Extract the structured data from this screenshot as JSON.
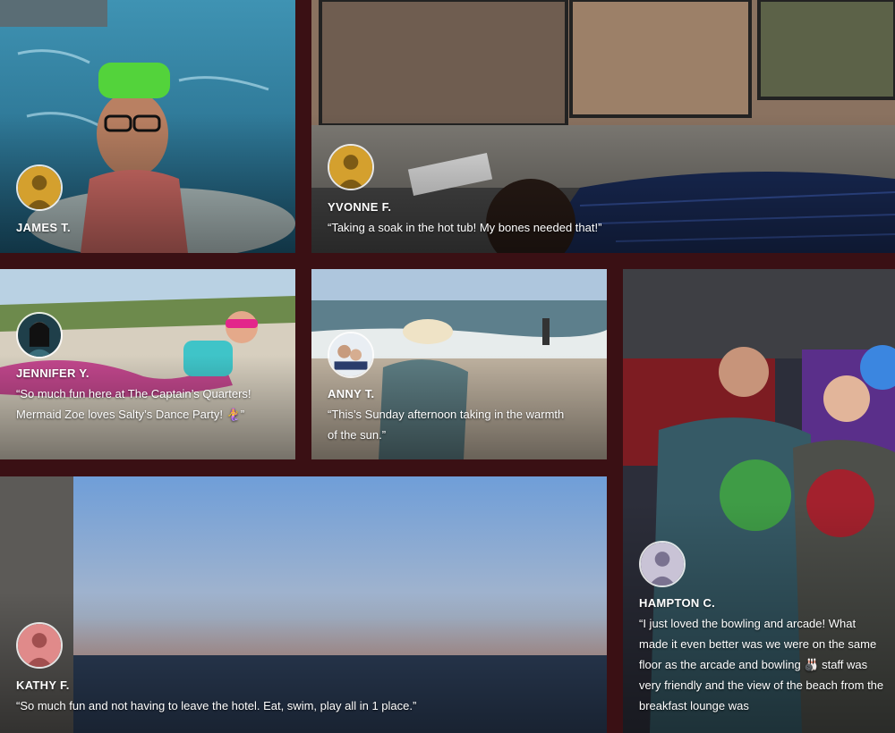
{
  "reviews": [
    {
      "name": "JAMES T.",
      "quote": ""
    },
    {
      "name": "YVONNE F.",
      "quote": "“Taking a soak in the hot tub! My bones needed that!”"
    },
    {
      "name": "JENNIFER Y.",
      "quote": "“So much fun here at The Captain’s Quarters! Mermaid Zoe loves Salty’s Dance Party! 🧜‍♀️”"
    },
    {
      "name": "ANNY T.",
      "quote": "“This’s Sunday afternoon taking in the warmth of the sun.”"
    },
    {
      "name": "KATHY F.",
      "quote": "“So much fun and not having to leave the hotel. Eat, swim, play all in 1 place.”"
    },
    {
      "name": "HAMPTON C.",
      "quote": "“I just loved the bowling and arcade! What made it even better was we were on the same floor as the arcade and bowling 🎳 staff was very friendly and the view of the beach from the breakfast lounge was"
    }
  ],
  "colors": {
    "background": "#3a1014",
    "avatar_james": "#d4a02e",
    "avatar_yvonne": "#d4a02e",
    "avatar_kathy": "#e08a8a",
    "avatar_hampton": "#c9c3d6"
  }
}
